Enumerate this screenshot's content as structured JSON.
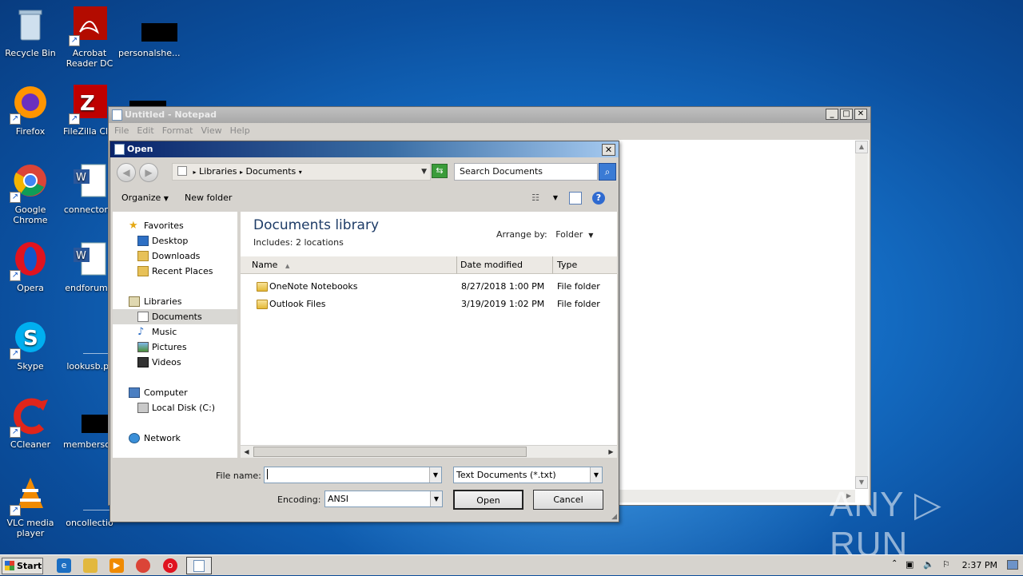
{
  "desktop": {
    "icons": [
      {
        "label": "Recycle Bin",
        "icon": "recycle-bin-icon"
      },
      {
        "label": "Acrobat Reader DC",
        "icon": "acrobat-icon"
      },
      {
        "label": "personalshe...",
        "icon": "file-icon"
      },
      {
        "label": "Firefox",
        "icon": "firefox-icon"
      },
      {
        "label": "FileZilla Clie",
        "icon": "filezilla-icon"
      },
      {
        "label": "Google Chrome",
        "icon": "chrome-icon"
      },
      {
        "label": "connectone",
        "icon": "word-doc-icon"
      },
      {
        "label": "Opera",
        "icon": "opera-icon"
      },
      {
        "label": "endforum.r",
        "icon": "word-doc-icon"
      },
      {
        "label": "Skype",
        "icon": "skype-icon"
      },
      {
        "label": "lookusb.pr",
        "icon": "file-icon"
      },
      {
        "label": "CCleaner",
        "icon": "ccleaner-icon"
      },
      {
        "label": "membersop",
        "icon": "file-icon"
      },
      {
        "label": "VLC media player",
        "icon": "vlc-icon"
      },
      {
        "label": "oncollectio",
        "icon": "file-icon"
      }
    ]
  },
  "notepad": {
    "title": "Untitled - Notepad",
    "menu": [
      "File",
      "Edit",
      "Format",
      "View",
      "Help"
    ],
    "min": "_",
    "max": "□",
    "close": "✕"
  },
  "dialog": {
    "title": "Open",
    "close": "✕",
    "breadcrumb": [
      "Libraries",
      "Documents"
    ],
    "search_placeholder": "Search Documents",
    "toolbar": {
      "organize": "Organize",
      "new_folder": "New folder"
    },
    "nav": {
      "favorites": "Favorites",
      "desktop": "Desktop",
      "downloads": "Downloads",
      "recent": "Recent Places",
      "libraries": "Libraries",
      "documents": "Documents",
      "music": "Music",
      "pictures": "Pictures",
      "videos": "Videos",
      "computer": "Computer",
      "local_disk": "Local Disk (C:)",
      "network": "Network"
    },
    "library_title": "Documents library",
    "library_sub": "Includes:  2 locations",
    "arrange_label": "Arrange by:",
    "arrange_value": "Folder",
    "columns": {
      "name": "Name",
      "date": "Date modified",
      "type": "Type"
    },
    "rows": [
      {
        "name": "OneNote Notebooks",
        "date": "8/27/2018 1:00 PM",
        "type": "File folder"
      },
      {
        "name": "Outlook Files",
        "date": "3/19/2019 1:02 PM",
        "type": "File folder"
      }
    ],
    "file_name_label": "File name:",
    "file_name_value": "",
    "file_type_value": "Text Documents (*.txt)",
    "encoding_label": "Encoding:",
    "encoding_value": "ANSI",
    "open_btn": "Open",
    "cancel_btn": "Cancel"
  },
  "taskbar": {
    "start": "Start",
    "clock": "2:37 PM"
  },
  "watermark": "ANY ▷ RUN"
}
